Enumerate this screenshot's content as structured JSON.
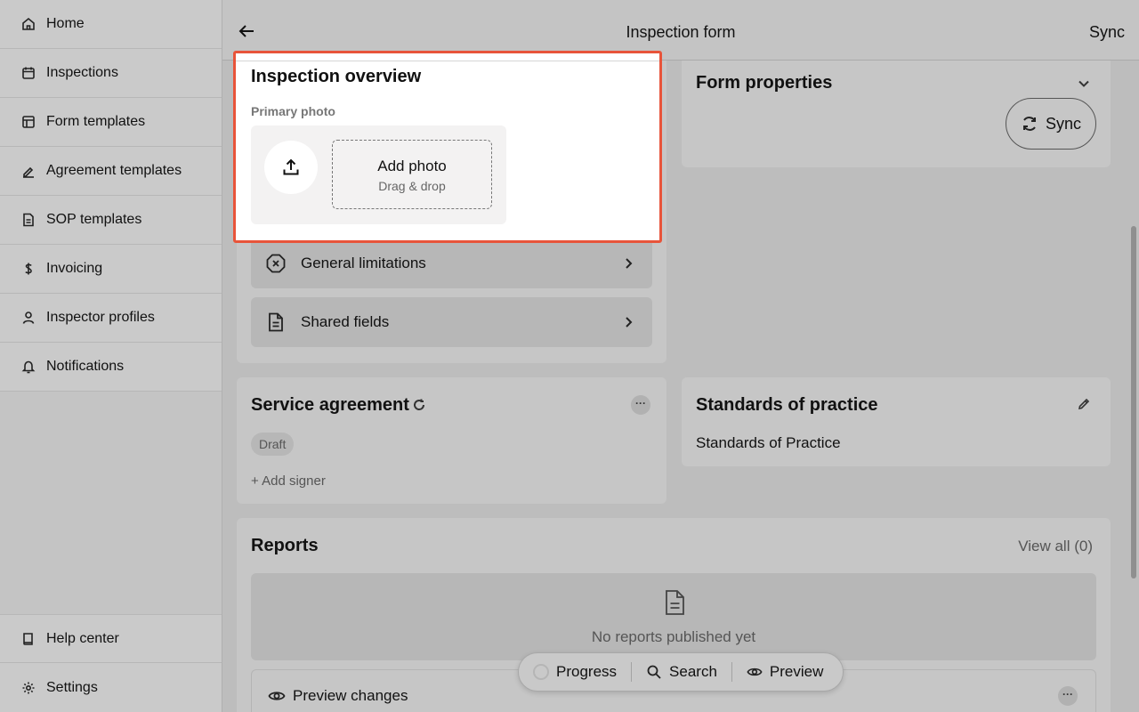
{
  "sidebar": {
    "items": [
      {
        "label": "Home",
        "icon": "home-icon"
      },
      {
        "label": "Inspections",
        "icon": "calendar-icon"
      },
      {
        "label": "Form templates",
        "icon": "layout-icon"
      },
      {
        "label": "Agreement templates",
        "icon": "signature-icon"
      },
      {
        "label": "SOP templates",
        "icon": "document-icon"
      },
      {
        "label": "Invoicing",
        "icon": "dollar-icon"
      },
      {
        "label": "Inspector profiles",
        "icon": "user-icon"
      },
      {
        "label": "Notifications",
        "icon": "bell-icon"
      }
    ],
    "bottom_items": [
      {
        "label": "Help center",
        "icon": "book-icon"
      },
      {
        "label": "Settings",
        "icon": "gear-icon"
      }
    ]
  },
  "header": {
    "title": "Inspection form",
    "sync_label": "Sync"
  },
  "overview": {
    "title": "Inspection overview",
    "photo_label": "Primary photo",
    "add_photo": "Add photo",
    "drag_drop": "Drag & drop",
    "accent_color": "#e8543a"
  },
  "left_rows": [
    {
      "label": "General limitations",
      "icon": "x-circle-icon"
    },
    {
      "label": "Shared fields",
      "icon": "document-icon"
    }
  ],
  "form_properties": {
    "title": "Form properties",
    "sync_button": "Sync"
  },
  "service_agreement": {
    "title": "Service agreement",
    "status": "Draft",
    "add_signer": "+ Add signer",
    "menu": "···"
  },
  "standards": {
    "title": "Standards of practice",
    "value": "Standards of Practice"
  },
  "reports": {
    "title": "Reports",
    "view_all": "View all (0)",
    "empty_text": "No reports published yet",
    "preview_changes": "Preview changes",
    "menu": "···"
  },
  "toolbar": {
    "progress": "Progress",
    "search": "Search",
    "preview": "Preview"
  }
}
